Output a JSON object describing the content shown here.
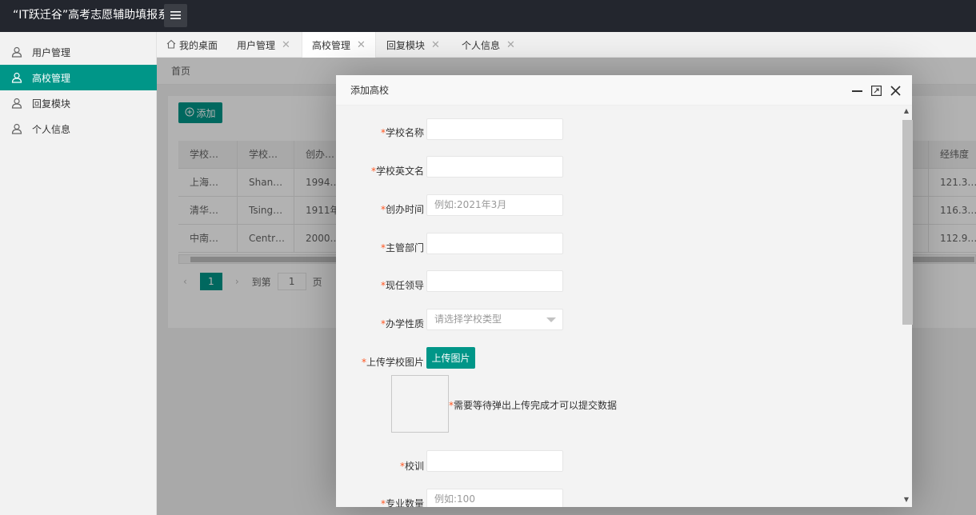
{
  "app": {
    "title": "“IT跃迁谷”高考志愿辅助填报系"
  },
  "sidebar": {
    "items": [
      {
        "label": "用户管理"
      },
      {
        "label": "高校管理"
      },
      {
        "label": "回复模块"
      },
      {
        "label": "个人信息"
      }
    ],
    "active_color": "#009688"
  },
  "tabs": [
    {
      "label": "我的桌面"
    },
    {
      "label": "用户管理"
    },
    {
      "label": "高校管理"
    },
    {
      "label": "回复模块"
    },
    {
      "label": "个人信息"
    }
  ],
  "content": {
    "breadcrumb": "首页",
    "add_label": "添加",
    "table": {
      "headers": [
        "学校…",
        "学校…",
        "创办…",
        "经纬度"
      ],
      "rows": [
        [
          "上海…",
          "Shan…",
          "1994…",
          "121.3…"
        ],
        [
          "清华…",
          "Tsing…",
          "1911年",
          "116.3…"
        ],
        [
          "中南…",
          "Centr…",
          "2000…",
          "112.9…"
        ]
      ]
    },
    "pager": {
      "page": "1",
      "goto_prefix": "到第",
      "goto_value": "1",
      "goto_suffix": "页"
    }
  },
  "modal": {
    "title": "添加高校",
    "fields": [
      {
        "req": "*",
        "label": "学校名称",
        "value": "",
        "placeholder": ""
      },
      {
        "req": "*",
        "label": "学校英文名",
        "value": "",
        "placeholder": ""
      },
      {
        "req": "*",
        "label": "创办时间",
        "value": "",
        "placeholder": "例如:2021年3月"
      },
      {
        "req": "*",
        "label": "主管部门",
        "value": "",
        "placeholder": ""
      },
      {
        "req": "*",
        "label": "现任领导",
        "value": "",
        "placeholder": ""
      },
      {
        "req": "*",
        "label": "办学性质",
        "value": "请选择学校类型",
        "placeholder": ""
      },
      {
        "req": "*",
        "label": "上传学校图片",
        "value": "",
        "placeholder": ""
      },
      {
        "req": "*",
        "label": "校训",
        "value": "",
        "placeholder": ""
      },
      {
        "req": "*",
        "label": "专业数量",
        "value": "",
        "placeholder": "例如:100"
      }
    ],
    "upload_label": "上传图片",
    "upload_hint_req": "*",
    "upload_hint": "需要等待弹出上传完成才可以提交数据",
    "required_color": "#ff5722"
  }
}
